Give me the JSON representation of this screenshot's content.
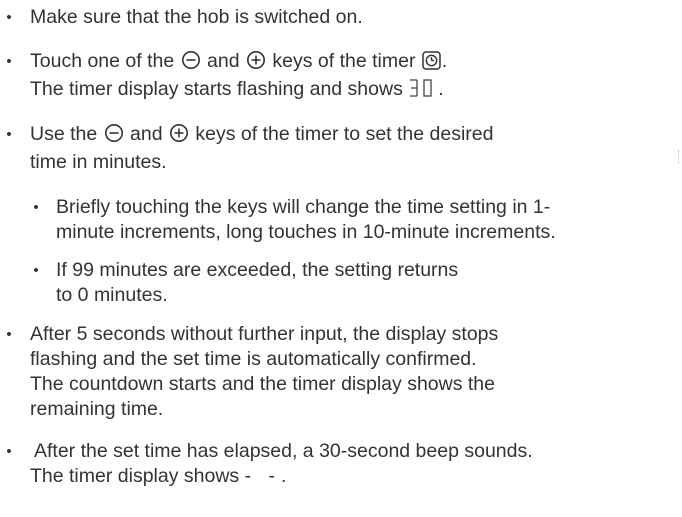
{
  "steps": [
    {
      "text": "Make sure that the hob is switched on."
    },
    {
      "line1_a": "Touch one of the ",
      "line1_b": " and ",
      "line1_c": " keys of the timer ",
      "line1_d": ".",
      "line2_a": "The timer display starts flashing and shows ",
      "line2_b": "."
    },
    {
      "line1_a": "Use the ",
      "line1_b": " and ",
      "line1_c": " keys of the timer to set the desired",
      "line2": "time in minutes.",
      "sub": [
        {
          "line1": "Briefly touching the keys will change the time setting in 1-",
          "line2": "minute increments, long touches in 10-minute increments."
        },
        {
          "line1": "If 99 minutes are exceeded, the setting returns",
          "line2": "to 0 minutes."
        }
      ]
    },
    {
      "line1": "After 5 seconds without further input, the display stops",
      "line2": "flashing and the set time is automatically confirmed.",
      "line3": "The countdown starts and the timer display shows the",
      "line4": "remaining time."
    },
    {
      "line1": "After the set time has elapsed, a 30-second beep sounds.",
      "line2_a": "The timer display shows ",
      "line2_dashes": "- -",
      "line2_b": "."
    }
  ],
  "icons": {
    "minus_key": "minus-circle-icon",
    "plus_key": "plus-circle-icon",
    "timer": "timer-clock-icon",
    "display_30": "seven-segment-30-icon"
  }
}
